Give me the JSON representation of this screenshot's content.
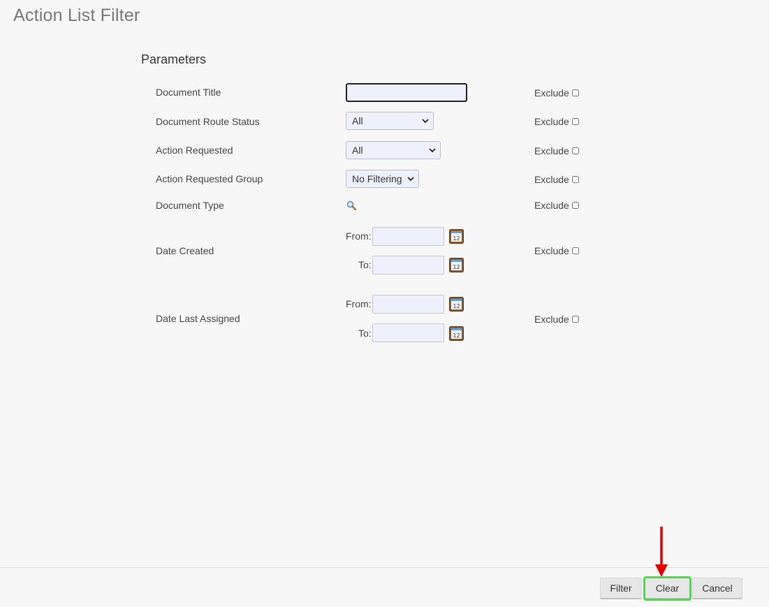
{
  "page": {
    "title": "Action List Filter"
  },
  "section": {
    "title": "Parameters"
  },
  "fields": {
    "document_title": {
      "label": "Document Title",
      "value": ""
    },
    "route_status": {
      "label": "Document Route Status",
      "selected": "All"
    },
    "action_requested": {
      "label": "Action Requested",
      "selected": "All"
    },
    "action_requested_group": {
      "label": "Action Requested Group",
      "selected": "No Filtering"
    },
    "document_type": {
      "label": "Document Type",
      "icon": "search-icon"
    },
    "date_created": {
      "label": "Date Created",
      "from_label": "From:",
      "to_label": "To:",
      "from_value": "",
      "to_value": ""
    },
    "date_last_assigned": {
      "label": "Date Last Assigned",
      "from_label": "From:",
      "to_label": "To:",
      "from_value": "",
      "to_value": ""
    }
  },
  "exclude_label": "Exclude",
  "buttons": {
    "filter": "Filter",
    "clear": "Clear",
    "cancel": "Cancel"
  },
  "colors": {
    "highlight": "#3ae63a",
    "arrow": "#e00000"
  }
}
